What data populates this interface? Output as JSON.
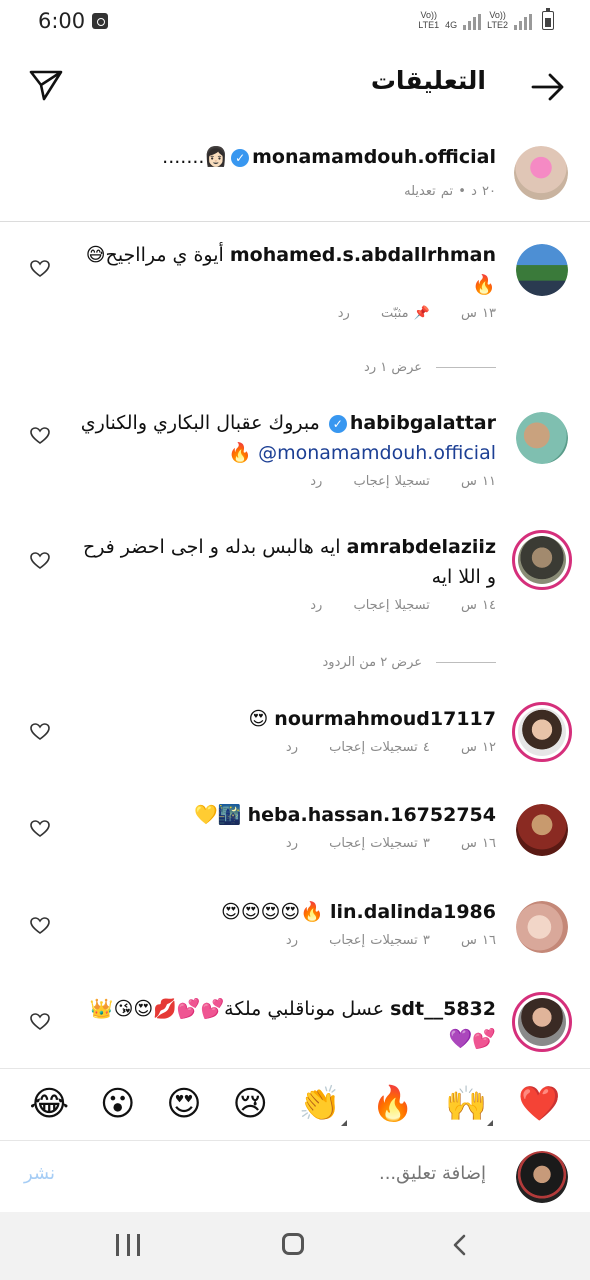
{
  "status_bar": {
    "time": "6:00",
    "sim1": "Vo))\nLTE1",
    "sim2": "Vo))\nLTE2",
    "net": "4G"
  },
  "header": {
    "title": "التعليقات"
  },
  "caption": {
    "username": "monamamdouh.official",
    "text": "👩🏻.......",
    "meta": "٢٠ د • تم تعديله"
  },
  "comments": [
    {
      "username": "mohamed.s.abdallrhman",
      "text": "أيوة ي مرااجيح😅🔥",
      "time": "١٣ س",
      "pinned": "مثبّت",
      "reply": "رد"
    },
    {
      "username": "habibgalattar",
      "text": "مبروك عقبال البكاري والكناري",
      "mention": "@monamamdouh.official",
      "tail": "🔥",
      "time": "١١ س",
      "likes": "تسجيلا إعجاب",
      "reply": "رد"
    },
    {
      "username": "amrabdelaziiz",
      "text": "ايه هالبس بدله و اجى احضر فرح و اللا ايه",
      "time": "١٤ س",
      "likes": "تسجيلا إعجاب",
      "reply": "رد"
    },
    {
      "username": "nourmahmoud17117",
      "text": "😍",
      "time": "١٢ س",
      "likes": "٤ تسجيلات إعجاب",
      "reply": "رد"
    },
    {
      "username": "heba.hassan.16752754",
      "text": "🌃💛",
      "time": "١٦ س",
      "likes": "٣ تسجيلات إعجاب",
      "reply": "رد"
    },
    {
      "username": "lin.dalinda1986",
      "text": "🔥😍😍😍😍",
      "time": "١٦ س",
      "likes": "٣ تسجيلات إعجاب",
      "reply": "رد"
    },
    {
      "username": "sdt__5832",
      "text": "عسل موناقلبي ملكة💕💕💋😍😘👑💕💜"
    }
  ],
  "view_replies": [
    "عرض ١ رد",
    "عرض ٢ من الردود"
  ],
  "emoji_bar": [
    "❤️",
    "🙌",
    "🔥",
    "👏",
    "😢",
    "😍",
    "😮",
    "😂"
  ],
  "input": {
    "placeholder": "إضافة تعليق...",
    "post": "نشر"
  },
  "colors": {
    "verified": "#3897f0",
    "story_ring": "#d52f7b",
    "post_disabled": "#a6cdf5",
    "mention": "#1c3f94"
  }
}
